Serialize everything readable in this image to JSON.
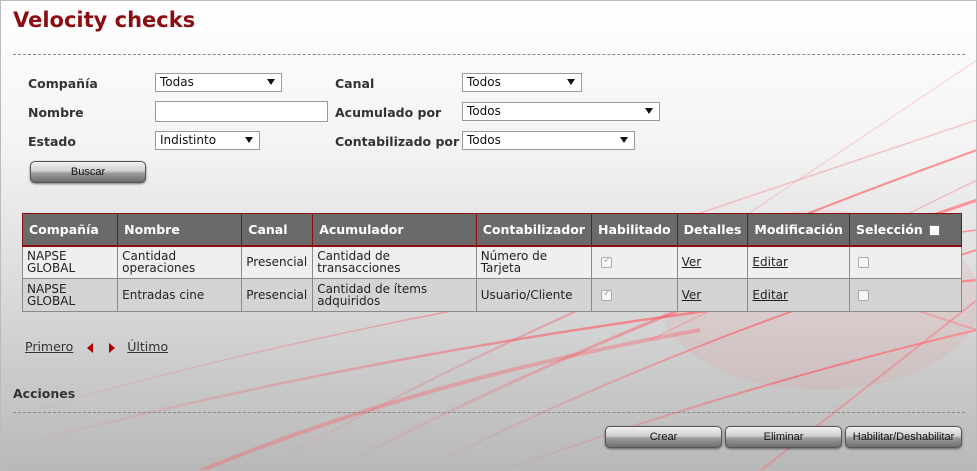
{
  "page": {
    "title": "Velocity checks"
  },
  "filters": {
    "company_label": "Compañía",
    "company_value": "Todas",
    "name_label": "Nombre",
    "name_value": "",
    "status_label": "Estado",
    "status_value": "Indistinto",
    "channel_label": "Canal",
    "channel_value": "Todos",
    "accumulated_label": "Acumulado por",
    "accumulated_value": "Todos",
    "counted_label": "Contabilizado por",
    "counted_value": "Todos",
    "search_button": "Buscar"
  },
  "table": {
    "headers": [
      "Compañía",
      "Nombre",
      "Canal",
      "Acumulador",
      "Contabilizador",
      "Habilitado",
      "Detalles",
      "Modificación",
      "Selección"
    ],
    "rows": [
      {
        "company": "NAPSE GLOBAL",
        "name": "Cantidad operaciones",
        "channel": "Presencial",
        "accumulator": "Cantidad de transacciones",
        "counter": "Número de Tarjeta",
        "enabled": true,
        "details_link": "Ver",
        "edit_link": "Editar",
        "selected": false
      },
      {
        "company": "NAPSE GLOBAL",
        "name": "Entradas cine",
        "channel": "Presencial",
        "accumulator": "Cantidad de ítems adquiridos",
        "counter": "Usuario/Cliente",
        "enabled": true,
        "details_link": "Ver",
        "edit_link": "Editar",
        "selected": false
      }
    ]
  },
  "pager": {
    "first": "Primero",
    "last": "Último"
  },
  "actions": {
    "label": "Acciones",
    "create": "Crear",
    "delete": "Eliminar",
    "toggle": "Habilitar/Deshabilitar"
  },
  "colors": {
    "brand": "#8b0d12",
    "header_bg": "#6a6a6a",
    "accent_red": "#e8464e"
  }
}
